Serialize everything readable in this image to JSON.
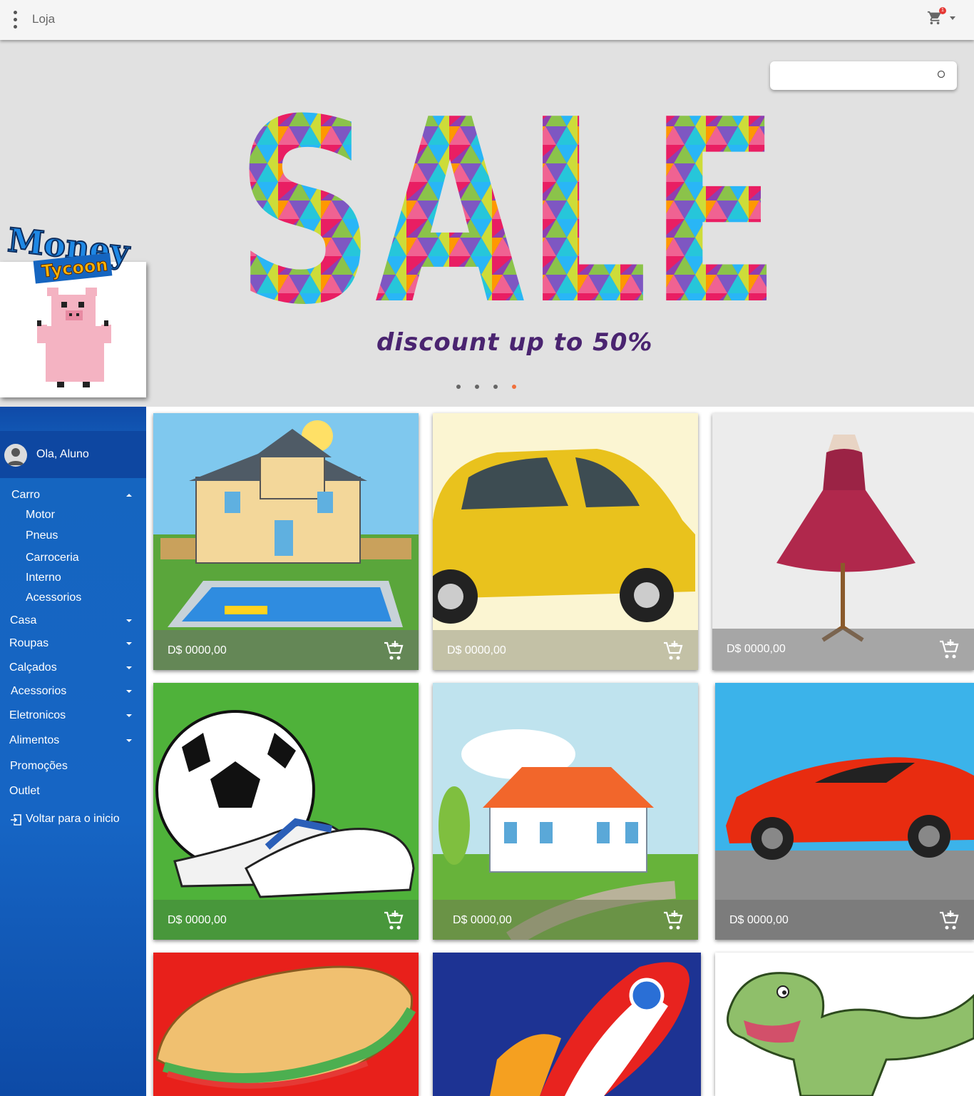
{
  "app": {
    "title": "Loja",
    "cart_count": "1"
  },
  "search": {
    "placeholder": ""
  },
  "hero": {
    "headline": "SALE",
    "subline": "discount up to 50%",
    "slides": 4,
    "active_slide": 4,
    "accent_color": "#f0703c"
  },
  "logo": {
    "line1": "Money",
    "line2": "Tycoon"
  },
  "sidebar": {
    "greeting": "Ola, Aluno",
    "categories": [
      {
        "label": "Carro",
        "expanded": true,
        "children": [
          "Motor",
          "Pneus",
          "Carroceria",
          "Interno",
          "Acessorios"
        ]
      },
      {
        "label": "Casa",
        "expanded": false
      },
      {
        "label": "Roupas",
        "expanded": false
      },
      {
        "label": "Calçados",
        "expanded": false
      },
      {
        "label": "Acessorios",
        "expanded": false
      },
      {
        "label": "Eletronicos",
        "expanded": false
      },
      {
        "label": "Alimentos",
        "expanded": false
      },
      {
        "label": "Promoções"
      },
      {
        "label": "Outlet"
      }
    ],
    "back_label": "Voltar para o inicio"
  },
  "products": [
    {
      "price": "D$ 0000,00",
      "image": "house-with-pool"
    },
    {
      "price": "D$ 0000,00",
      "image": "yellow-car"
    },
    {
      "price": "D$ 0000,00",
      "image": "red-dress"
    },
    {
      "price": "D$ 0000,00",
      "image": "football-and-boots"
    },
    {
      "price": "D$ 0000,00",
      "image": "white-house"
    },
    {
      "price": "D$ 0000,00",
      "image": "red-sports-car"
    },
    {
      "price": "",
      "image": "sandwich"
    },
    {
      "price": "",
      "image": "rocket"
    },
    {
      "price": "",
      "image": "dinosaur"
    }
  ],
  "icons": [
    "more-vert-icon",
    "shopping-cart-icon",
    "search-icon",
    "user-icon",
    "exit-icon",
    "add-to-cart-icon"
  ]
}
